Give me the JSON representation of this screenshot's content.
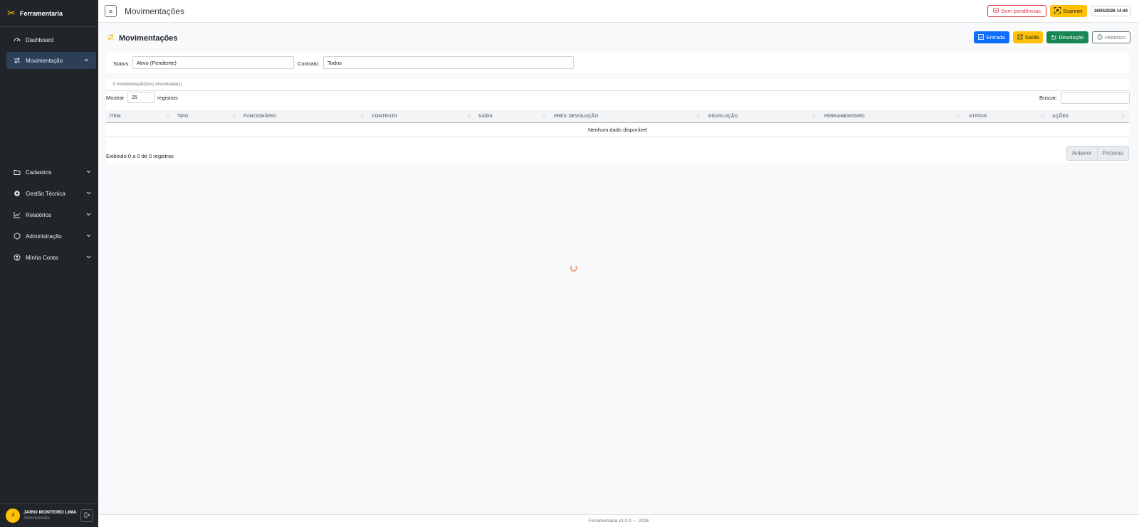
{
  "sidebar": {
    "brand": "Ferramentaria",
    "items": [
      {
        "label": "Dashboard"
      },
      {
        "label": "Movimentação"
      },
      {
        "label": "Cadastros"
      },
      {
        "label": "Gestão Técnica"
      },
      {
        "label": "Relatórios"
      },
      {
        "label": "Administração"
      },
      {
        "label": "Minha Conta"
      }
    ],
    "user": {
      "initial": "J",
      "name": "JAIRO MONTEIRO LIMA",
      "role": "Administrador"
    }
  },
  "topbar": {
    "title": "Movimentações",
    "pending_label": "Sem pendências",
    "scanner_label": "Scanner",
    "datetime": "26/05/2026 14:44"
  },
  "page": {
    "title": "Movimentações",
    "actions": {
      "entrada": "Entrada",
      "saida": "Saída",
      "devolucao": "Devolução",
      "historico": "Histórico"
    }
  },
  "filters": {
    "status_label": "Status:",
    "status_value": "Ativo (Pendente)",
    "contrato_label": "Contrato:",
    "contrato_value": "Todos"
  },
  "table": {
    "count_text": "0 movimentação(ões) encontrada(s)",
    "show_label": "Mostrar",
    "show_value": "25",
    "records_label": "registros",
    "search_label": "Buscar:",
    "columns": [
      "ITEM",
      "TIPO",
      "FUNCIONÁRIO",
      "CONTRATO",
      "SAÍDA",
      "PREV. DEVOLUÇÃO",
      "DEVOLUÇÃO",
      "FERRAMENTEIRO",
      "STATUS",
      "AÇÕES"
    ],
    "empty_text": "Nenhum dado disponível",
    "info_text": "Exibindo 0 a 0 de 0 registros",
    "prev_label": "Anterior",
    "next_label": "Próximo"
  },
  "footer": {
    "text": "Ferramentaria v1.0.0 — 2026"
  },
  "colors": {
    "sidebar_bg": "#212529",
    "accent": "#ffc107",
    "primary": "#0d6efd",
    "success": "#198754",
    "danger": "#dc3545"
  }
}
